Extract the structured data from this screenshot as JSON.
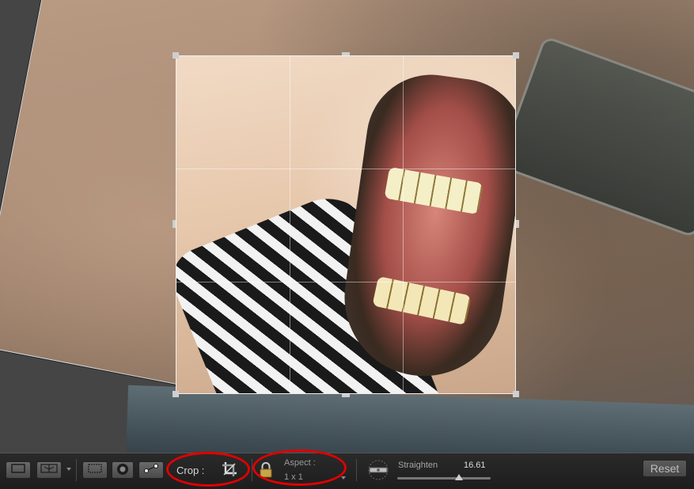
{
  "toolbar": {
    "crop_label": "Crop :",
    "aspect_label": "Aspect :",
    "aspect_value": "1 x 1",
    "straighten_label": "Straighten",
    "straighten_value": "16.61",
    "straighten_fraction": 0.66,
    "reset_label": "Reset"
  },
  "icons": {
    "view_single": "rectangle-view-icon",
    "view_compare": "compare-view-icon",
    "crop_overlay": "crop-overlay-icon",
    "spot_removal": "spot-removal-icon",
    "graduated": "graduated-filter-icon",
    "crop_tool": "crop-tool-icon",
    "lock": "lock-icon",
    "level": "straighten-level-icon"
  },
  "colors": {
    "highlight": "#e00000",
    "toolbar_bg": "#1d1d1d",
    "canvas_bg": "#454545"
  }
}
